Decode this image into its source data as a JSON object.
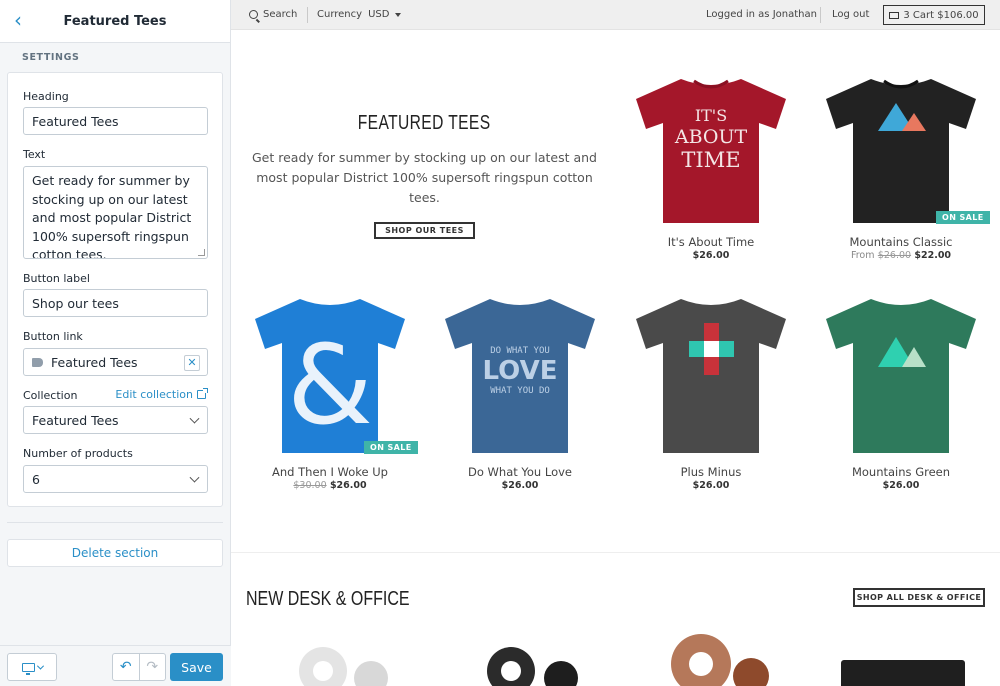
{
  "sidebar": {
    "title": "Featured Tees",
    "section_label": "SETTINGS",
    "fields": {
      "heading_label": "Heading",
      "heading_value": "Featured Tees",
      "text_label": "Text",
      "text_value": "Get ready for summer by stocking up on our latest and most popular District 100% supersoft ringspun cotton tees.",
      "button_label_label": "Button label",
      "button_label_value": "Shop our tees",
      "button_link_label": "Button link",
      "button_link_value": "Featured Tees",
      "collection_label": "Collection",
      "edit_collection": "Edit collection",
      "collection_value": "Featured Tees",
      "num_products_label": "Number of products",
      "num_products_value": "6"
    },
    "delete_label": "Delete section",
    "save_label": "Save"
  },
  "topbar": {
    "search": "Search",
    "currency_label": "Currency",
    "currency_value": "USD",
    "logged_in": "Logged in as Jonathan",
    "logout": "Log out",
    "cart": "3 Cart $106.00"
  },
  "featured": {
    "heading": "FEATURED TEES",
    "body": "Get ready for summer by stocking up on our latest and most popular District 100% supersoft ringspun cotton tees.",
    "button": "SHOP OUR TEES"
  },
  "products": [
    {
      "title": "It's About Time",
      "price": "$26.00",
      "color": "#a4172a",
      "print": "It's About Time"
    },
    {
      "title": "Mountains Classic",
      "from": "From",
      "old_price": "$26.00",
      "price": "$22.00",
      "badge": "ON SALE",
      "color": "#222222"
    },
    {
      "title": "And Then I Woke Up",
      "old_price": "$30.00",
      "price": "$26.00",
      "badge": "ON SALE",
      "color": "#1f7fd6"
    },
    {
      "title": "Do What You Love",
      "price": "$26.00",
      "color": "#3b6796",
      "print": "DO WHAT YOU LOVE WHAT YOU DO"
    },
    {
      "title": "Plus Minus",
      "price": "$26.00",
      "color": "#4a4a4a"
    },
    {
      "title": "Mountains Green",
      "price": "$26.00",
      "color": "#2e7a5c"
    }
  ],
  "desk": {
    "heading": "NEW DESK & OFFICE",
    "button": "SHOP ALL DESK & OFFICE"
  }
}
